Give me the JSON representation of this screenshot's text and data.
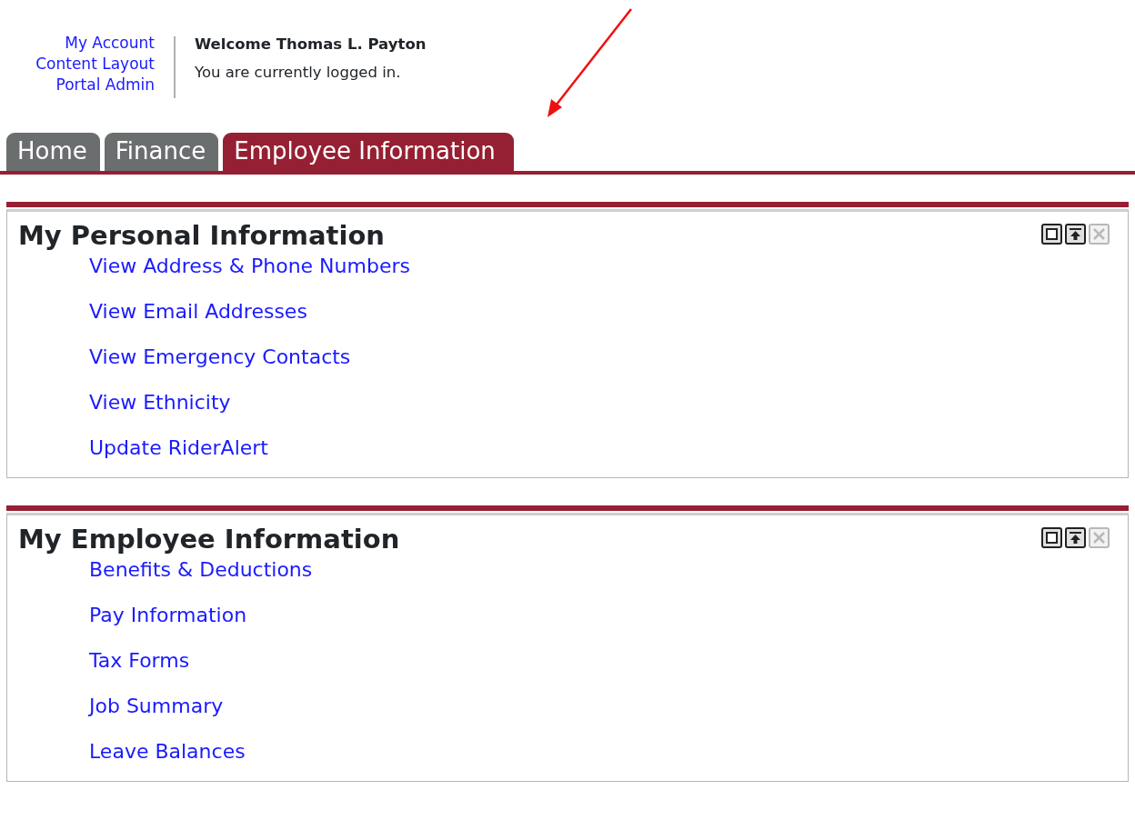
{
  "account_links": [
    "My Account",
    "Content Layout",
    "Portal Admin"
  ],
  "welcome": {
    "title": "Welcome Thomas L. Payton",
    "status": "You are currently logged in."
  },
  "tabs": [
    {
      "label": "Home",
      "selected": false
    },
    {
      "label": "Finance",
      "selected": false
    },
    {
      "label": "Employee Information",
      "selected": true
    }
  ],
  "annotation": {
    "kind": "arrow"
  },
  "portlets": [
    {
      "title": "My Personal Information",
      "controls": [
        {
          "kind": "maximize",
          "disabled": false
        },
        {
          "kind": "minimize",
          "disabled": false
        },
        {
          "kind": "close",
          "disabled": true
        }
      ],
      "links": [
        "View Address & Phone Numbers",
        "View Email Addresses",
        "View Emergency Contacts",
        "View Ethnicity",
        "Update RiderAlert"
      ]
    },
    {
      "title": "My Employee Information",
      "controls": [
        {
          "kind": "maximize",
          "disabled": false
        },
        {
          "kind": "minimize",
          "disabled": false
        },
        {
          "kind": "close",
          "disabled": true
        }
      ],
      "links": [
        "Benefits & Deductions",
        "Pay Information",
        "Tax Forms",
        "Job Summary",
        "Leave Balances"
      ]
    }
  ]
}
